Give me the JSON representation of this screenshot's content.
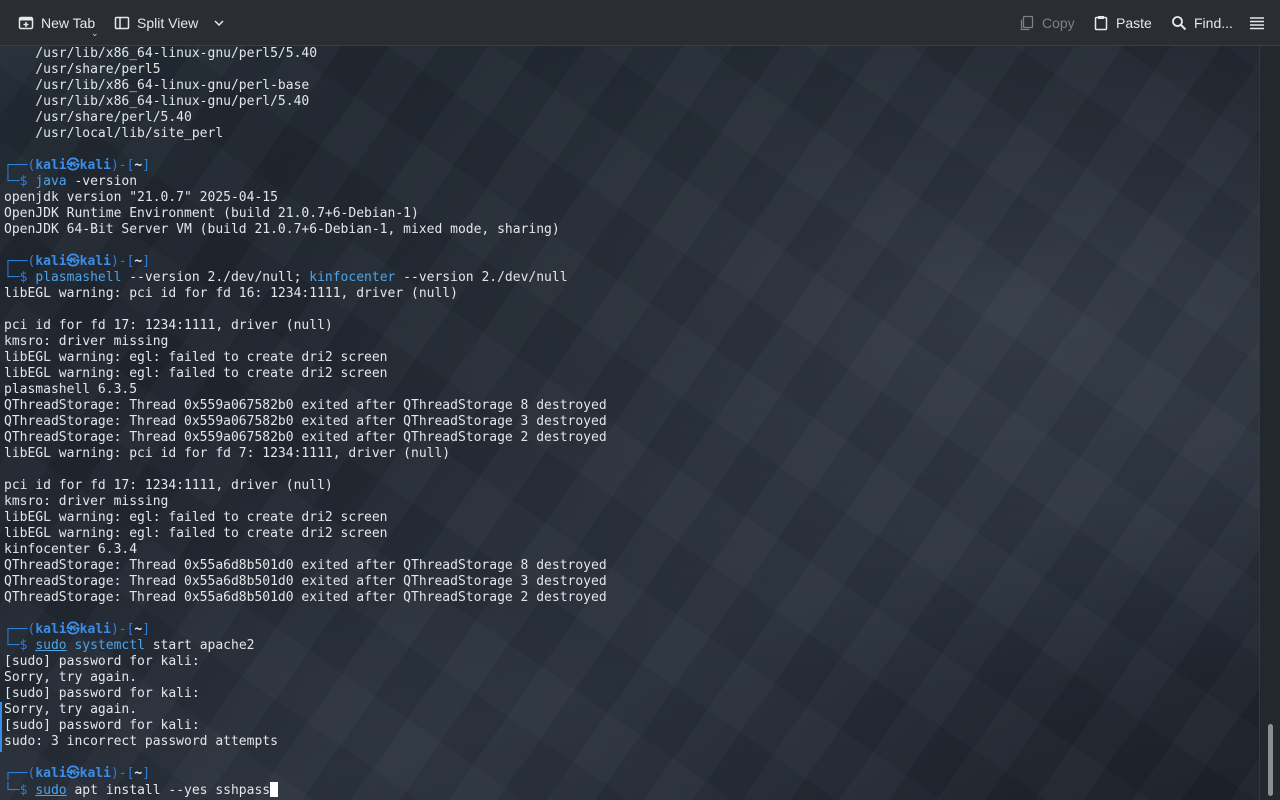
{
  "toolbar": {
    "new_tab": "New Tab",
    "split_view": "Split View",
    "copy": "Copy",
    "paste": "Paste",
    "find": "Find..."
  },
  "prompt": {
    "user": "kali",
    "at": "㉿",
    "host": "kali",
    "cwd": "~"
  },
  "lines": [
    {
      "kind": "out",
      "text": "    /usr/lib/x86_64-linux-gnu/perl5/5.40"
    },
    {
      "kind": "out",
      "text": "    /usr/share/perl5"
    },
    {
      "kind": "out",
      "text": "    /usr/lib/x86_64-linux-gnu/perl-base"
    },
    {
      "kind": "out",
      "text": "    /usr/lib/x86_64-linux-gnu/perl/5.40"
    },
    {
      "kind": "out",
      "text": "    /usr/share/perl/5.40"
    },
    {
      "kind": "out",
      "text": "    /usr/local/lib/site_perl"
    },
    {
      "kind": "blank",
      "text": ""
    },
    {
      "kind": "prompt",
      "text": ""
    },
    {
      "kind": "cmd",
      "parts": [
        {
          "t": "java",
          "c": "exe"
        },
        {
          "t": " -version",
          "c": "arg"
        }
      ]
    },
    {
      "kind": "out",
      "text": "openjdk version \"21.0.7\" 2025-04-15"
    },
    {
      "kind": "out",
      "text": "OpenJDK Runtime Environment (build 21.0.7+6-Debian-1)"
    },
    {
      "kind": "out",
      "text": "OpenJDK 64-Bit Server VM (build 21.0.7+6-Debian-1, mixed mode, sharing)"
    },
    {
      "kind": "blank",
      "text": ""
    },
    {
      "kind": "prompt",
      "text": ""
    },
    {
      "kind": "cmd",
      "parts": [
        {
          "t": "plasmashell",
          "c": "exe"
        },
        {
          "t": " --version ",
          "c": "arg"
        },
        {
          "t": "2./dev/null; ",
          "c": "arg2"
        },
        {
          "t": "kinfocenter",
          "c": "exe"
        },
        {
          "t": " --version ",
          "c": "arg"
        },
        {
          "t": "2./dev/null",
          "c": "arg2"
        }
      ]
    },
    {
      "kind": "out",
      "text": "libEGL warning: pci id for fd 16: 1234:1111, driver (null)"
    },
    {
      "kind": "blank",
      "text": ""
    },
    {
      "kind": "out",
      "text": "pci id for fd 17: 1234:1111, driver (null)"
    },
    {
      "kind": "out",
      "text": "kmsro: driver missing"
    },
    {
      "kind": "out",
      "text": "libEGL warning: egl: failed to create dri2 screen"
    },
    {
      "kind": "out",
      "text": "libEGL warning: egl: failed to create dri2 screen"
    },
    {
      "kind": "out",
      "text": "plasmashell 6.3.5"
    },
    {
      "kind": "out",
      "text": "QThreadStorage: Thread 0x559a067582b0 exited after QThreadStorage 8 destroyed"
    },
    {
      "kind": "out",
      "text": "QThreadStorage: Thread 0x559a067582b0 exited after QThreadStorage 3 destroyed"
    },
    {
      "kind": "out",
      "text": "QThreadStorage: Thread 0x559a067582b0 exited after QThreadStorage 2 destroyed"
    },
    {
      "kind": "out",
      "text": "libEGL warning: pci id for fd 7: 1234:1111, driver (null)"
    },
    {
      "kind": "blank",
      "text": ""
    },
    {
      "kind": "out",
      "text": "pci id for fd 17: 1234:1111, driver (null)"
    },
    {
      "kind": "out",
      "text": "kmsro: driver missing"
    },
    {
      "kind": "out",
      "text": "libEGL warning: egl: failed to create dri2 screen"
    },
    {
      "kind": "out",
      "text": "libEGL warning: egl: failed to create dri2 screen"
    },
    {
      "kind": "out",
      "text": "kinfocenter 6.3.4"
    },
    {
      "kind": "out",
      "text": "QThreadStorage: Thread 0x55a6d8b501d0 exited after QThreadStorage 8 destroyed"
    },
    {
      "kind": "out",
      "text": "QThreadStorage: Thread 0x55a6d8b501d0 exited after QThreadStorage 3 destroyed"
    },
    {
      "kind": "out",
      "text": "QThreadStorage: Thread 0x55a6d8b501d0 exited after QThreadStorage 2 destroyed"
    },
    {
      "kind": "blank",
      "text": ""
    },
    {
      "kind": "prompt",
      "text": ""
    },
    {
      "kind": "cmd",
      "parts": [
        {
          "t": "sudo",
          "c": "sudo"
        },
        {
          "t": " ",
          "c": "arg"
        },
        {
          "t": "systemctl",
          "c": "exe"
        },
        {
          "t": " start apache2",
          "c": "arg"
        }
      ]
    },
    {
      "kind": "out",
      "text": "[sudo] password for kali:"
    },
    {
      "kind": "out",
      "text": "Sorry, try again."
    },
    {
      "kind": "out",
      "text": "[sudo] password for kali:"
    },
    {
      "kind": "out",
      "text": "Sorry, try again."
    },
    {
      "kind": "out",
      "text": "[sudo] password for kali:"
    },
    {
      "kind": "out",
      "text": "sudo: 3 incorrect password attempts"
    },
    {
      "kind": "blank",
      "text": ""
    },
    {
      "kind": "prompt",
      "text": ""
    },
    {
      "kind": "cmd",
      "cursor": true,
      "parts": [
        {
          "t": "sudo",
          "c": "sudo"
        },
        {
          "t": " apt install --yes sshpass",
          "c": "arg"
        }
      ]
    }
  ],
  "colors": {
    "prompt_frame": "#2f7fd6",
    "prompt_user": "#3b8ee8",
    "command": "#4ea3e6",
    "text": "#e4e6e8",
    "background": "#1d232b"
  },
  "icons": [
    "new-tab-icon",
    "split-view-icon",
    "chevron-down-icon",
    "copy-icon",
    "paste-icon",
    "search-icon",
    "hamburger-menu-icon"
  ]
}
